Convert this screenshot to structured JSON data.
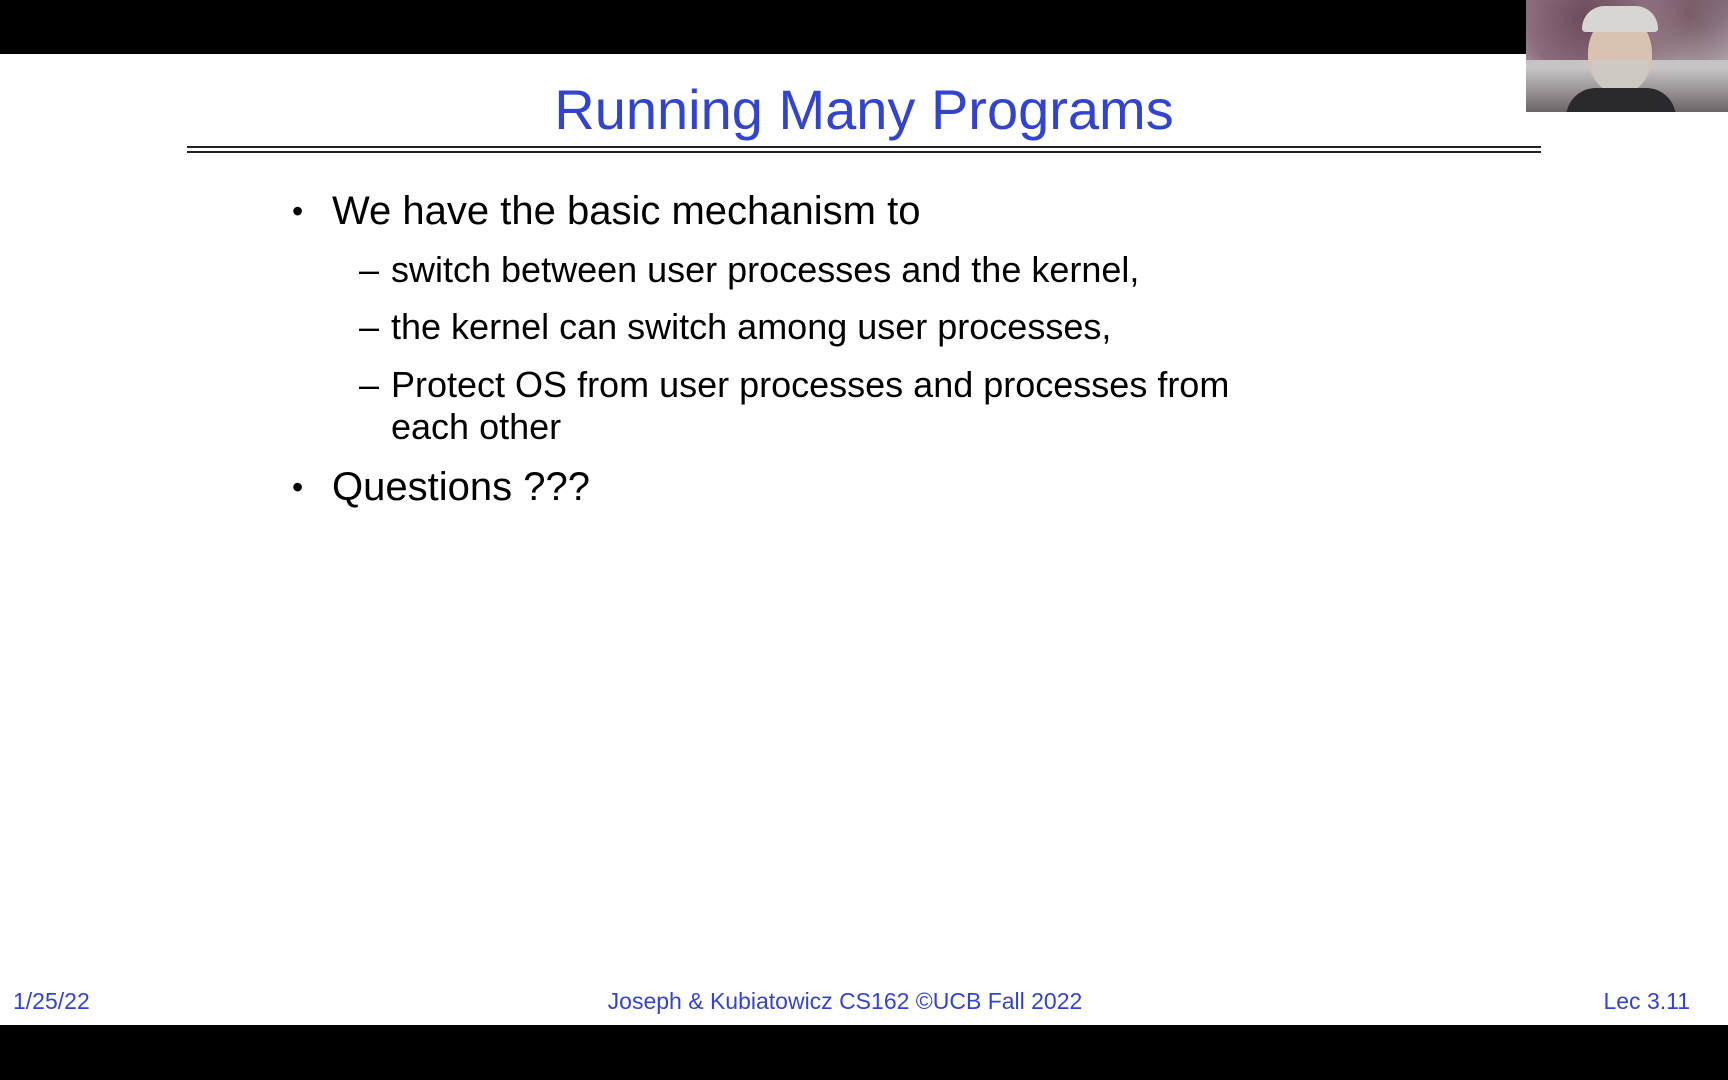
{
  "slide": {
    "title": "Running Many Programs",
    "bullets": [
      {
        "symbol": "•",
        "text": "We have the basic mechanism to",
        "subitems": [
          {
            "symbol": "–",
            "text": "switch between user processes and the kernel,"
          },
          {
            "symbol": "–",
            "text": "the kernel can switch among user processes,"
          },
          {
            "symbol": "–",
            "line1": "Protect OS from user processes and processes from",
            "line2": "each other"
          }
        ]
      },
      {
        "symbol": "•",
        "text": "Questions ???"
      }
    ],
    "footer": {
      "date": "1/25/22",
      "course": "Joseph & Kubiatowicz CS162 ©UCB Fall 2022",
      "slide_number": "Lec 3.11"
    }
  },
  "colors": {
    "title": "#3344cc",
    "footer": "#3344cc",
    "body_text": "#000000",
    "background": "#ffffff",
    "letterbox": "#000000"
  }
}
